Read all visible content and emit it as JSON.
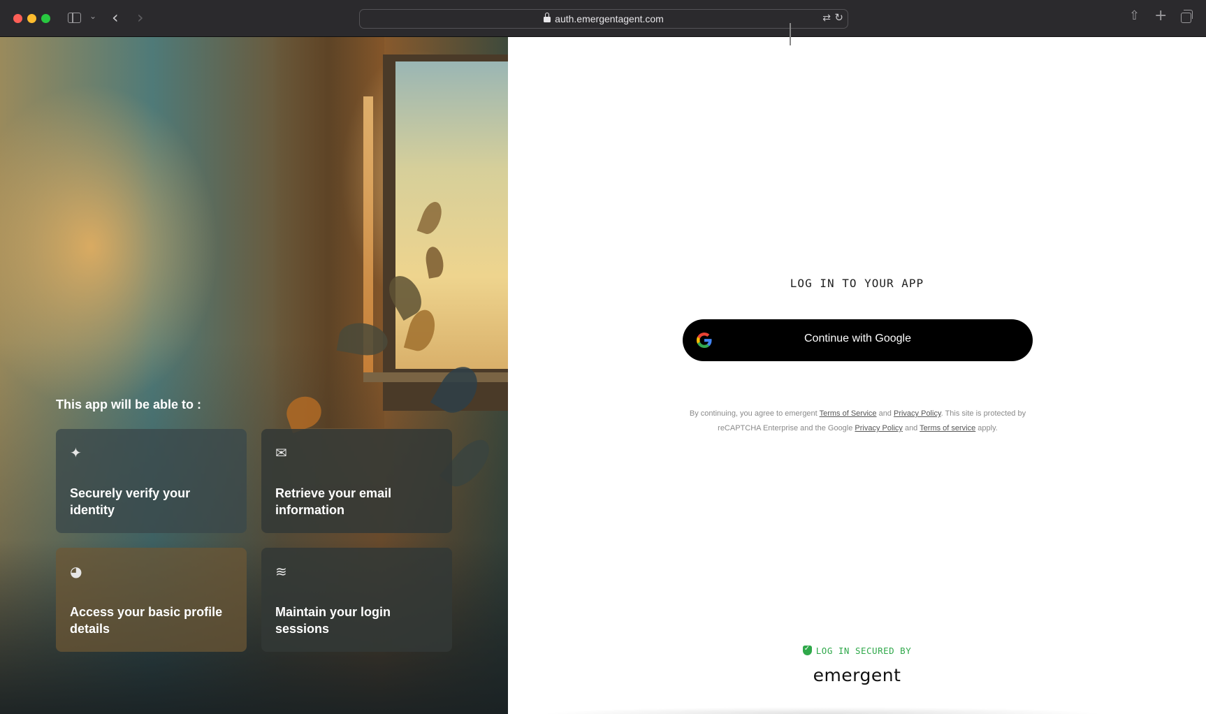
{
  "browser": {
    "url": "auth.emergentagent.com",
    "icons": [
      "sidebar-icon",
      "chevron-down-icon",
      "back-icon",
      "forward-icon",
      "lock-icon",
      "translate-icon",
      "reload-icon",
      "share-icon",
      "new-tab-icon",
      "tab-overview-icon"
    ]
  },
  "left": {
    "heading": "This app will be able to :",
    "permissions": [
      {
        "icon": "sparkle-icon",
        "label": "Securely verify your identity"
      },
      {
        "icon": "email-icon",
        "label": "Retrieve your email information"
      },
      {
        "icon": "profile-icon",
        "label": "Access your basic profile details"
      },
      {
        "icon": "layers-icon",
        "label": "Maintain your login sessions"
      }
    ]
  },
  "right": {
    "title": "LOG IN TO YOUR APP",
    "google_button": "Continue with Google",
    "legal": {
      "part1": "By continuing, you agree to emergent ",
      "terms_link": "Terms of Service",
      "and1": " and ",
      "privacy_link": "Privacy Policy",
      "part2": ". This site is protected by reCAPTCHA Enterprise and the Google ",
      "google_privacy_link": "Privacy Policy",
      "and2": " and ",
      "google_terms_link": "Terms of service",
      "part3": " apply."
    },
    "secured_by": "LOG IN SECURED BY",
    "brand": "emergent"
  },
  "colors": {
    "accent_green": "#2fa84a",
    "button_black": "#000000"
  }
}
